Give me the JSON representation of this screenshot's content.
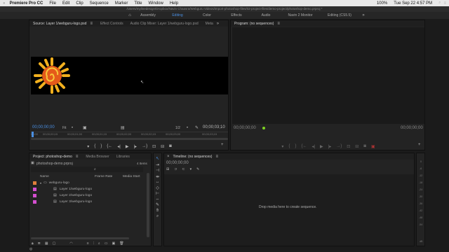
{
  "menubar": {
    "app": "Premiere Pro CC",
    "items": [
      "File",
      "Edit",
      "Clip",
      "Sequence",
      "Marker",
      "Title",
      "Window",
      "Help"
    ],
    "time": "Tue Sep 22  4:57 PM",
    "battery": "100%"
  },
  "titlebar": {
    "path": "/Users/mylinedesign/Dropbox/Navin Chaasra/Webguru Videos/import-photoshop-files/02-project-files/demo-project/photoshop-demo.prproj *"
  },
  "workspaces": [
    "Assembly",
    "Editing",
    "Color",
    "Effects",
    "Audio",
    "Navin 2 Monitor",
    "Editing (CS5.5)"
  ],
  "workspace_active": "Editing",
  "source": {
    "tabs": [
      "Source: Layer 1/webguru-logo.psd",
      "Effect Controls",
      "Audio Clip Mixer: Layer 1/webguru-logo.psd",
      "Meta"
    ],
    "timecode_left": "00;00;00;00",
    "fit": "Fit",
    "quality": "1/2",
    "timecode_right": "00;00;03;10",
    "ruler": [
      "00;00",
      "00;00;00;15",
      "00;00;01;00",
      "00;00;01;15",
      "00;00;02;00",
      "00;00;02;15",
      "00;00;03;00",
      "00;00;03;15"
    ]
  },
  "program": {
    "tab": "Program: (no sequences)",
    "timecode_left": "00;00;00;00",
    "timecode_right": "00;00;00;00"
  },
  "project": {
    "tabs": [
      "Project: photoshop-demo",
      "Media Browser",
      "Libraries"
    ],
    "file": "photoshop-demo.prproj",
    "count": "4 Items",
    "columns": {
      "name": "Name",
      "frame_rate": "Frame Rate",
      "media_start": "Media Start"
    },
    "folder": "webguru-logo",
    "items": [
      "Layer 1/webguru-logo",
      "Layer 2/webguru-logo",
      "Layer 3/webguru-logo"
    ]
  },
  "timeline": {
    "tab": "Timeline: (no sequences)",
    "timecode": "00;00;00;00",
    "drop_message": "Drop media here to create sequence."
  },
  "audio_meter": {
    "labels": [
      "0",
      "-6",
      "-12",
      "-18",
      "-24",
      "-30",
      "-36",
      "-42",
      "-48",
      "-54"
    ],
    "footer": "dB"
  },
  "colors": {
    "accent": "#4a8fe2",
    "folder": "#e07f3b",
    "psd": "#d54fd0",
    "green": "#7ed321"
  }
}
